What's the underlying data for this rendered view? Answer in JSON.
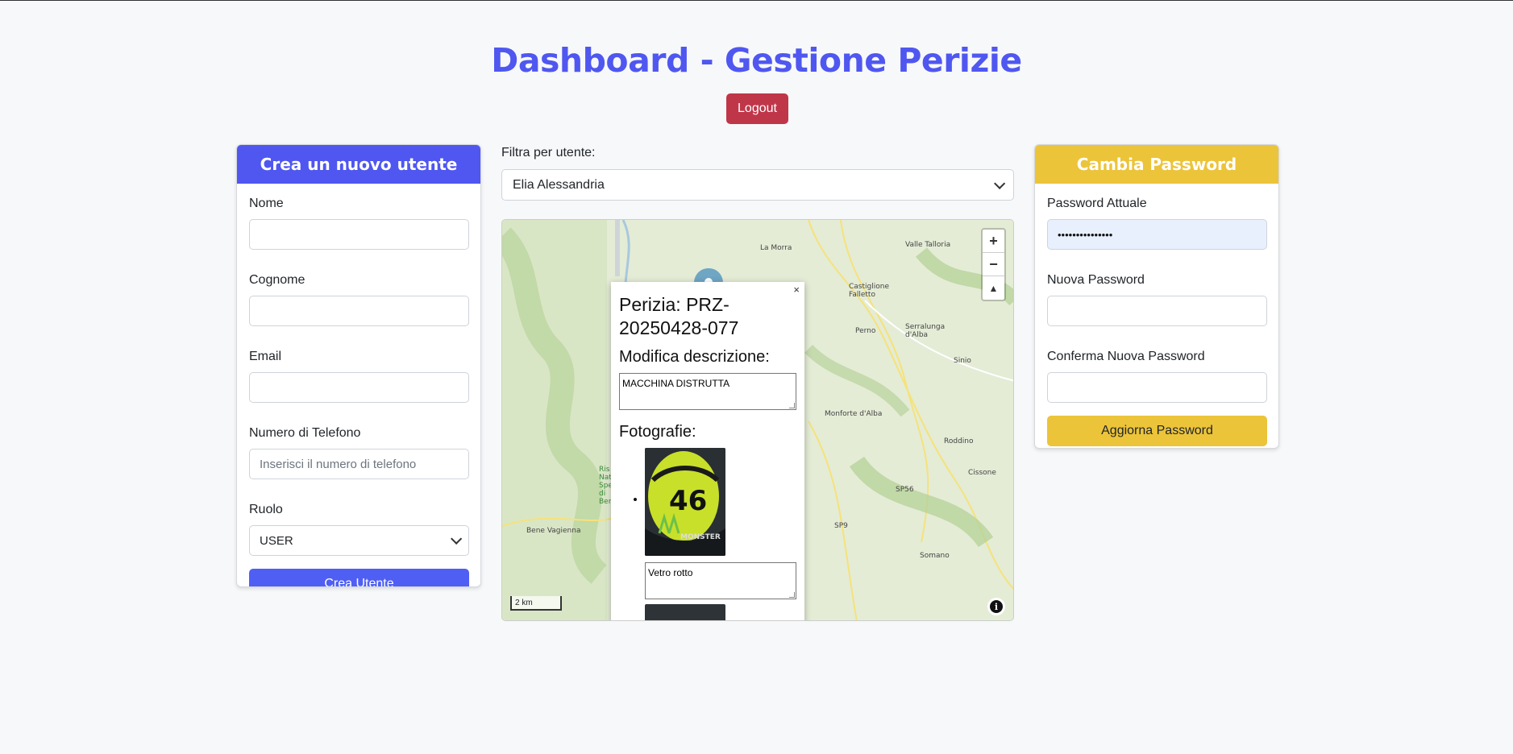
{
  "page": {
    "title": "Dashboard - Gestione Perizie",
    "logout_label": "Logout"
  },
  "create_user": {
    "header": "Crea un nuovo utente",
    "nome_label": "Nome",
    "nome_value": "",
    "cognome_label": "Cognome",
    "cognome_value": "",
    "email_label": "Email",
    "email_value": "",
    "telefono_label": "Numero di Telefono",
    "telefono_placeholder": "Inserisci il numero di telefono",
    "ruolo_label": "Ruolo",
    "ruolo_value": "USER",
    "submit_label": "Crea Utente"
  },
  "filter": {
    "label": "Filtra per utente:",
    "selected": "Elia Alessandria"
  },
  "map": {
    "places": [
      "La Morra",
      "Valle Talloria",
      "Castiglione Falletto",
      "Perno",
      "Serralunga d'Alba",
      "Sinio",
      "Monforte d'Alba",
      "Roddino",
      "Cissone",
      "SP56",
      "SP9",
      "Somano",
      "Bene Vagienna",
      "Ris Nat Spe di Bene"
    ],
    "scale_label": "2 km",
    "zoom_in": "+",
    "zoom_out": "−",
    "reset_north": "▲",
    "info": "i"
  },
  "popup": {
    "close": "×",
    "title": "Perizia: PRZ-20250428-077",
    "edit_label": "Modifica descrizione:",
    "description": "MACCHINA DISTRUTTA",
    "photos_label": "Fotografie:",
    "photos": [
      {
        "caption": "Vetro rotto",
        "number": "46",
        "brand": "MONSTER"
      }
    ]
  },
  "change_password": {
    "header": "Cambia Password",
    "current_label": "Password Attuale",
    "current_value": "•••••••••••••••",
    "new_label": "Nuova Password",
    "new_value": "",
    "confirm_label": "Conferma Nuova Password",
    "confirm_value": "",
    "submit_label": "Aggiorna Password"
  },
  "colors": {
    "primary": "#4f57f0",
    "danger": "#c03649",
    "warning": "#ecc43a"
  }
}
